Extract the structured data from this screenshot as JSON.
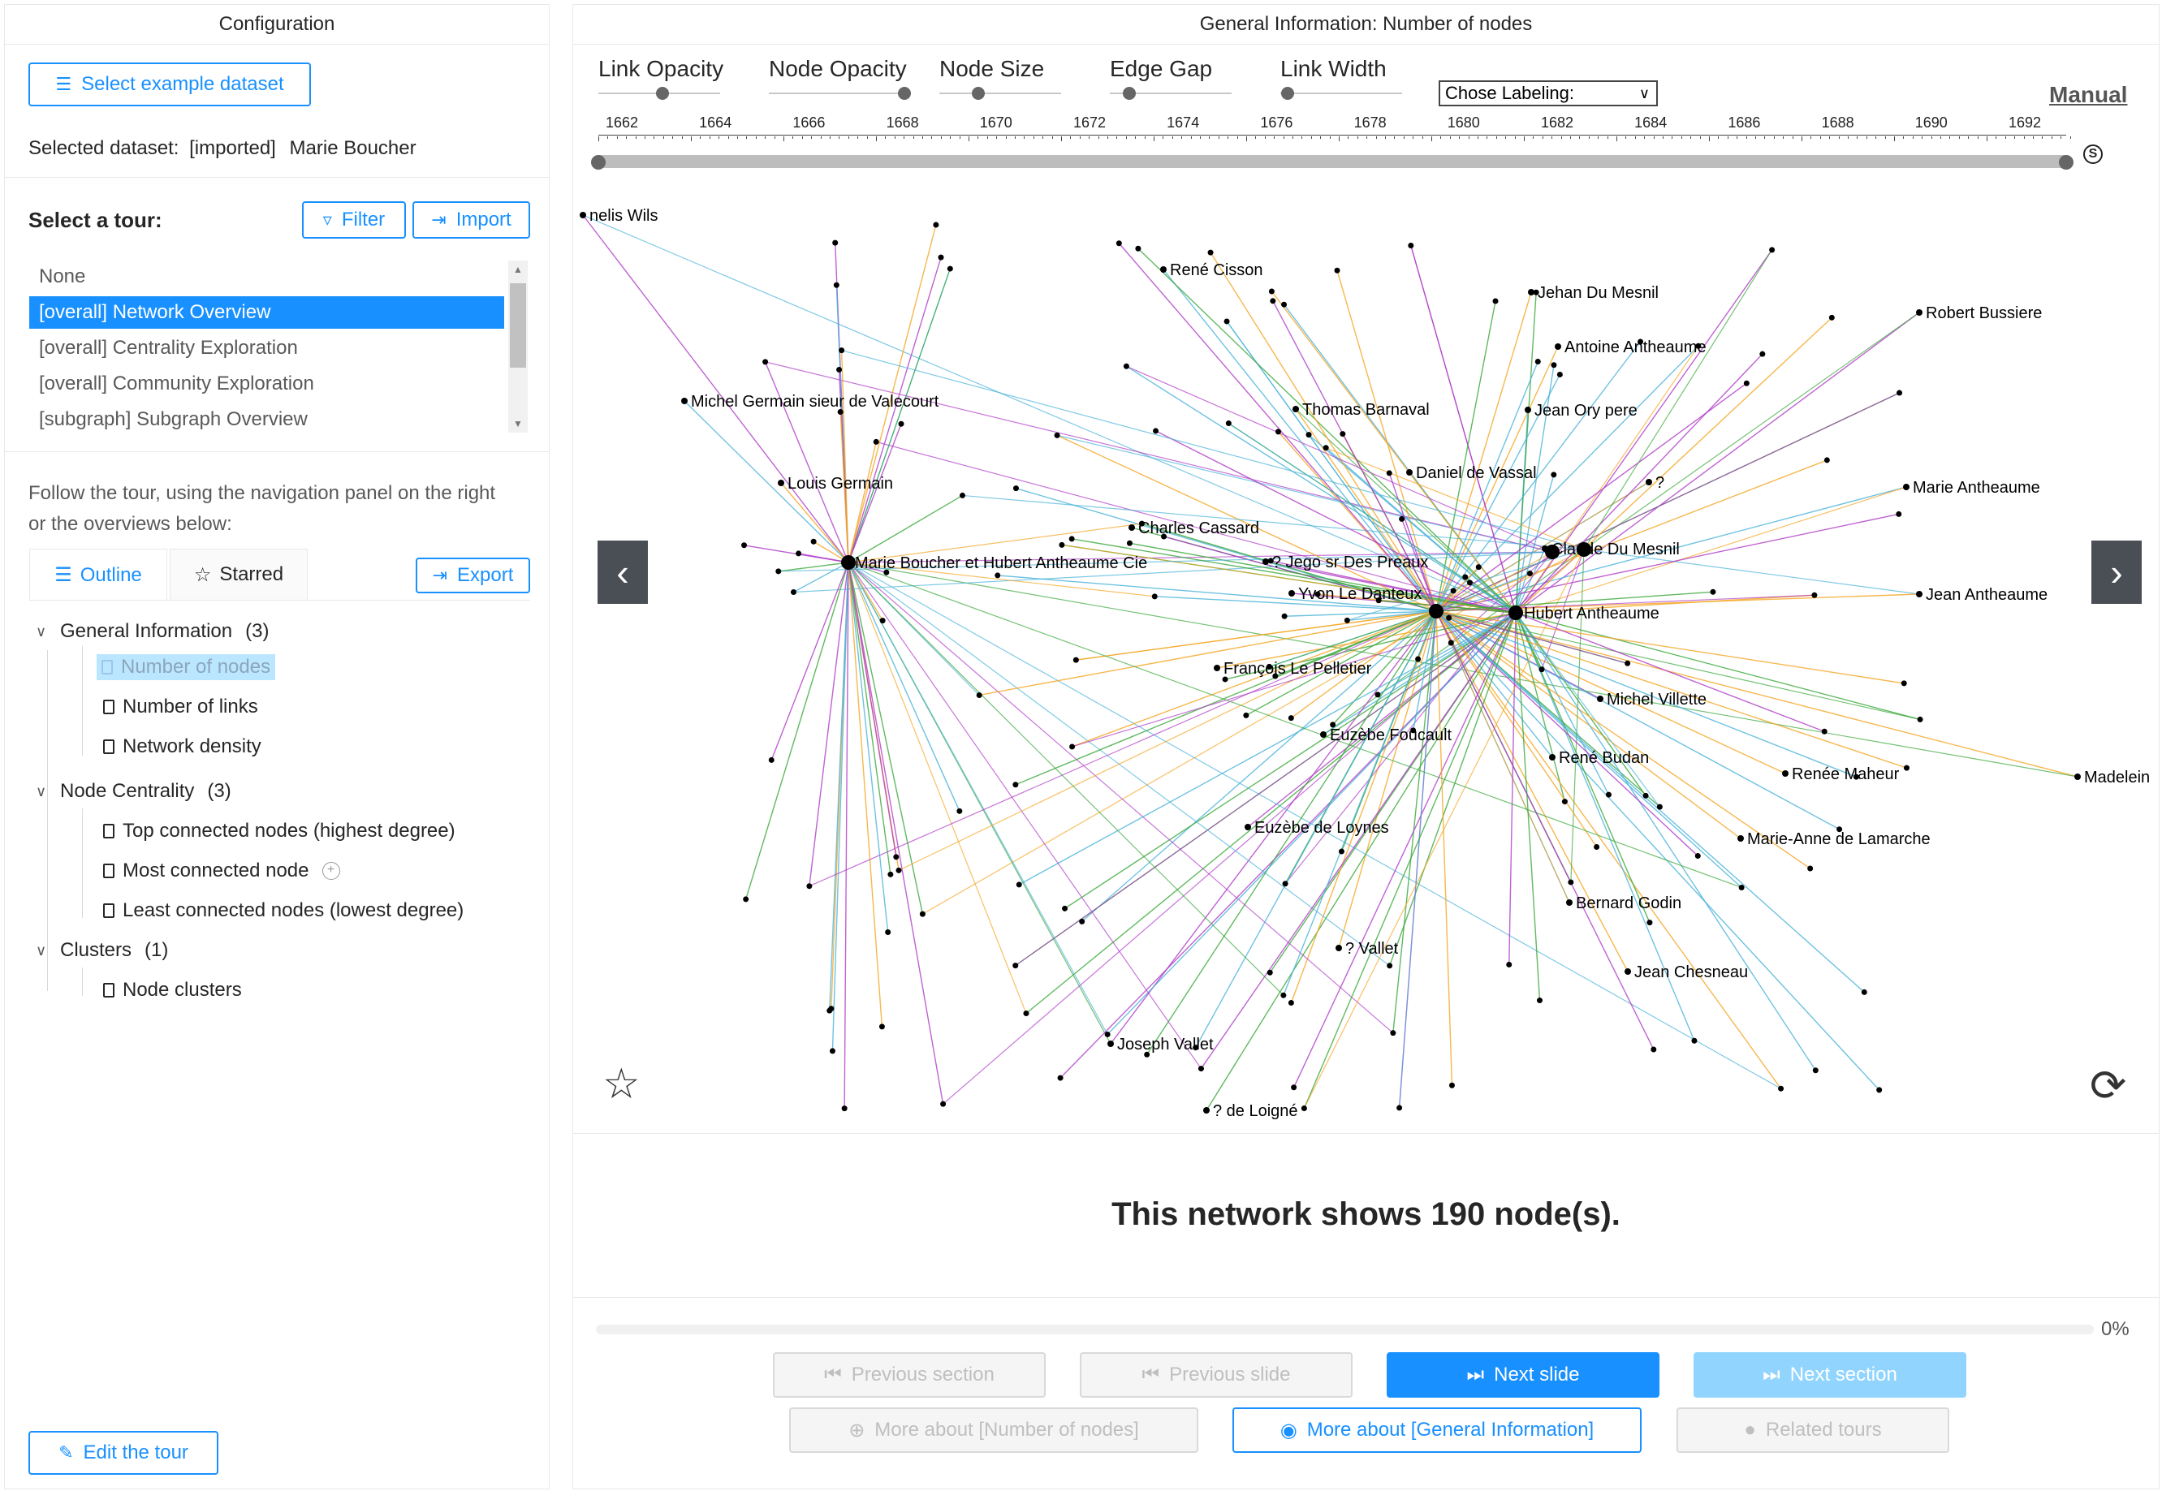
{
  "left": {
    "title": "Configuration",
    "select_dataset_label": "Select example dataset",
    "selected_dataset_prefix": "Selected dataset:",
    "selected_dataset_tag": "[imported]",
    "selected_dataset_name": "Marie Boucher",
    "select_tour_label": "Select a tour:",
    "filter_label": "Filter",
    "import_label": "Import",
    "tours": [
      {
        "label": "None",
        "selected": false
      },
      {
        "label": "[overall]  Network Overview",
        "selected": true
      },
      {
        "label": "[overall]  Centrality Exploration",
        "selected": false
      },
      {
        "label": "[overall]  Community Exploration",
        "selected": false
      },
      {
        "label": "[subgraph]  Subgraph Overview",
        "selected": false
      }
    ],
    "follow_text_1": "Follow the tour, using the navigation panel on the right",
    "follow_text_2": "or the overviews below:",
    "tab_outline": "Outline",
    "tab_starred": "Starred",
    "export_label": "Export",
    "tree": {
      "g1": "General Information",
      "g1_count": "(3)",
      "g1_items": [
        "Number of nodes",
        "Number of links",
        "Network density"
      ],
      "g2": "Node Centrality",
      "g2_count": "(3)",
      "g2_items": [
        "Top connected nodes (highest degree)",
        "Most connected node",
        "Least connected nodes (lowest degree)"
      ],
      "g3": "Clusters",
      "g3_count": "(1)",
      "g3_items": [
        "Node clusters"
      ]
    },
    "edit_tour_label": "Edit the tour"
  },
  "right": {
    "title": "General Information: Number of nodes",
    "sliders": [
      "Link Opacity",
      "Node Opacity",
      "Node Size",
      "Edge Gap",
      "Link Width"
    ],
    "labeling_select": "Chose Labeling:",
    "manual_label": "Manual",
    "timeline_ticks": [
      "1662",
      "1664",
      "1666",
      "1668",
      "1670",
      "1672",
      "1674",
      "1676",
      "1678",
      "1680",
      "1682",
      "1684",
      "1686",
      "1688",
      "1690",
      "1692"
    ],
    "timeline_end_symbol": "S",
    "node_labels": [
      "nelis Wils",
      "René Cisson",
      "Jehan Du Mesnil",
      "Robert Bussiere",
      "Antoine Antheaume",
      "Michel Germain sieur de Valecourt",
      "Thomas Barnaval",
      "Jean Ory pere",
      "Daniel de Vassal",
      "?",
      "Louis Germain",
      "Charles Cassard",
      "Marie Antheaume",
      "? Jego sr Des Preaux",
      "Claude Du Mesnil",
      "Marie Boucher et Hubert Antheaume Cie",
      "Yvon Le Danteux",
      "Hubert Antheaume",
      "Jean Antheaume",
      "François Le Pelletier",
      "Michel Villette",
      "Euzèbe Foucault",
      "René Budan",
      "Renée Maheur",
      "Madelein",
      "Euzèbe de Loynes",
      "Marie-Anne de Lamarche",
      "Bernard Godin",
      "? Vallet",
      "Jean Chesneau",
      "Joseph Vallet",
      "? de Loigné"
    ],
    "summary": "This network shows 190 node(s).",
    "progress_percent": "0%",
    "btn_prev_section": "Previous section",
    "btn_prev_slide": "Previous slide",
    "btn_next_slide": "Next slide",
    "btn_next_section": "Next section",
    "btn_more_nodes": "More about [Number of nodes]",
    "btn_more_general": "More about [General Information]",
    "btn_related": "Related tours"
  },
  "colors": {
    "accent": "#1890ff",
    "edge_blue": "#4ab3d9",
    "edge_orange": "#f5a623",
    "edge_green": "#3aa83a",
    "edge_purple": "#b03cc8"
  }
}
